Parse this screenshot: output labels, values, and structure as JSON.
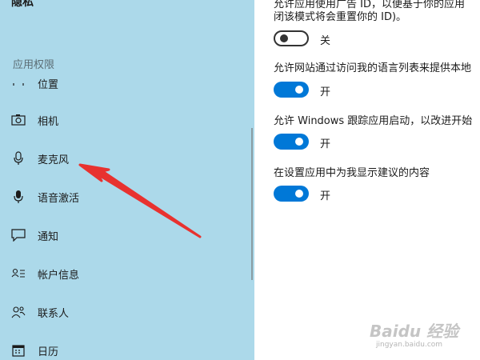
{
  "sidebar": {
    "title": "隐私",
    "section_label": "应用权限",
    "items": [
      {
        "label": "位置",
        "icon": "location-icon"
      },
      {
        "label": "相机",
        "icon": "camera-icon"
      },
      {
        "label": "麦克风",
        "icon": "microphone-icon"
      },
      {
        "label": "语音激活",
        "icon": "voice-activation-icon"
      },
      {
        "label": "通知",
        "icon": "notification-icon"
      },
      {
        "label": "帐户信息",
        "icon": "account-info-icon"
      },
      {
        "label": "联系人",
        "icon": "contacts-icon"
      },
      {
        "label": "日历",
        "icon": "calendar-icon"
      }
    ]
  },
  "content": {
    "line1": "允许应用使用广告 ID，以便基于你的应用",
    "line2": "闭该模式将会重置你的 ID)。",
    "toggle1": {
      "label": "关",
      "state": "off"
    },
    "setting2": "允许网站通过访问我的语言列表来提供本地",
    "toggle2": {
      "label": "开",
      "state": "on"
    },
    "setting3": "允许 Windows 跟踪应用启动，以改进开始",
    "toggle3": {
      "label": "开",
      "state": "on"
    },
    "setting4": "在设置应用中为我显示建议的内容",
    "toggle4": {
      "label": "开",
      "state": "on"
    }
  },
  "watermark": {
    "brand": "Baidu 经验",
    "sub": "jingyan.baidu.com"
  },
  "colors": {
    "sidebar_bg": "#acd9ea",
    "toggle_on": "#0078d7",
    "arrow": "#e8322f"
  }
}
